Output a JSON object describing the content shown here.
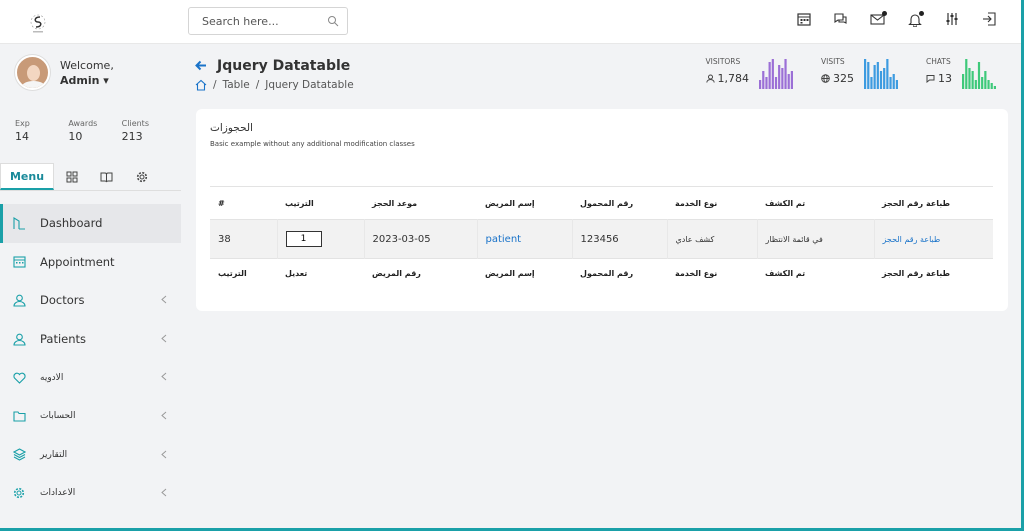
{
  "search": {
    "placeholder": "Search here..."
  },
  "profile": {
    "welcome": "Welcome,",
    "name": "Admin ▾"
  },
  "stats": [
    {
      "label": "Exp",
      "value": "14"
    },
    {
      "label": "Awards",
      "value": "10"
    },
    {
      "label": "Clients",
      "value": "213"
    }
  ],
  "side_tabs": {
    "menu": "Menu"
  },
  "nav": [
    {
      "label": "Dashboard"
    },
    {
      "label": "Appointment"
    },
    {
      "label": "Doctors"
    },
    {
      "label": "Patients"
    },
    {
      "label": "الادويه"
    },
    {
      "label": "الحسابات"
    },
    {
      "label": "التقارير"
    },
    {
      "label": "الاعدادات"
    }
  ],
  "page": {
    "title": "Jquery Datatable",
    "breadcrumb": [
      "Table",
      "/",
      "Jquery Datatable"
    ]
  },
  "kpis": [
    {
      "label": "VISITORS",
      "value": "1,784",
      "color": "#9b6fd6",
      "bars": [
        3,
        6,
        4,
        9,
        10,
        4,
        8,
        7,
        10,
        5,
        6
      ]
    },
    {
      "label": "VISITS",
      "value": "325",
      "color": "#3d9be0",
      "bars": [
        10,
        9,
        4,
        8,
        9,
        6,
        7,
        10,
        4,
        5,
        3
      ]
    },
    {
      "label": "CHATS",
      "value": "13",
      "color": "#3ec97a",
      "bars": [
        5,
        10,
        7,
        6,
        3,
        9,
        4,
        6,
        3,
        2,
        1
      ]
    }
  ],
  "card": {
    "title": "الحجوزات",
    "subtitle": "Basic example without any additional modification classes"
  },
  "table": {
    "headers": [
      "#",
      "الترتيب",
      "موعد الحجز",
      "إسم المريض",
      "رقم المحمول",
      "نوع الخدمة",
      "تم الكشف",
      "طباعة رقم الحجز"
    ],
    "row": {
      "id": "38",
      "order": "1",
      "date": "2023-03-05",
      "patient": "patient",
      "mobile": "123456",
      "service": "كشف عادي",
      "status": "في قائمة الانتظار",
      "print": "طباعة رقم الحجز"
    },
    "footers": [
      "الترتيب",
      "تعديل",
      "رقم المريض",
      "إسم المريض",
      "رقم المحمول",
      "نوع الخدمة",
      "تم الكشف",
      "طباعة رقم الحجز"
    ]
  }
}
